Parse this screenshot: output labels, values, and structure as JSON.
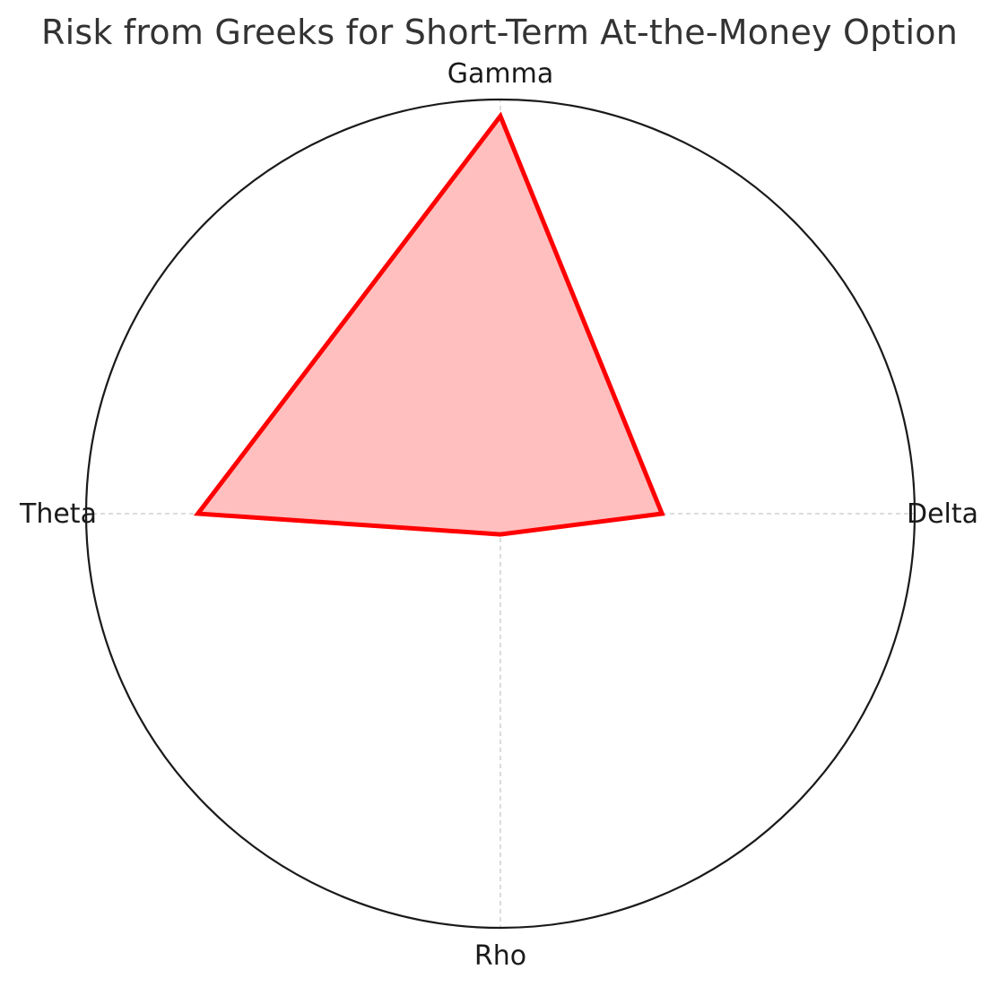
{
  "chart_data": {
    "type": "radar",
    "title": "Risk from Greeks for Short-Term At-the-Money Option",
    "categories": [
      "Delta",
      "Gamma",
      "Theta",
      "Rho"
    ],
    "series": [
      {
        "values": [
          0.39,
          0.96,
          0.73,
          0.05
        ]
      }
    ],
    "rlim": [
      0,
      1
    ],
    "grid": true,
    "colors": {
      "line": "#ff0000",
      "fill": "#ffbfbf",
      "frame": "#1a1a1a",
      "grid": "#c8c8c8"
    }
  }
}
